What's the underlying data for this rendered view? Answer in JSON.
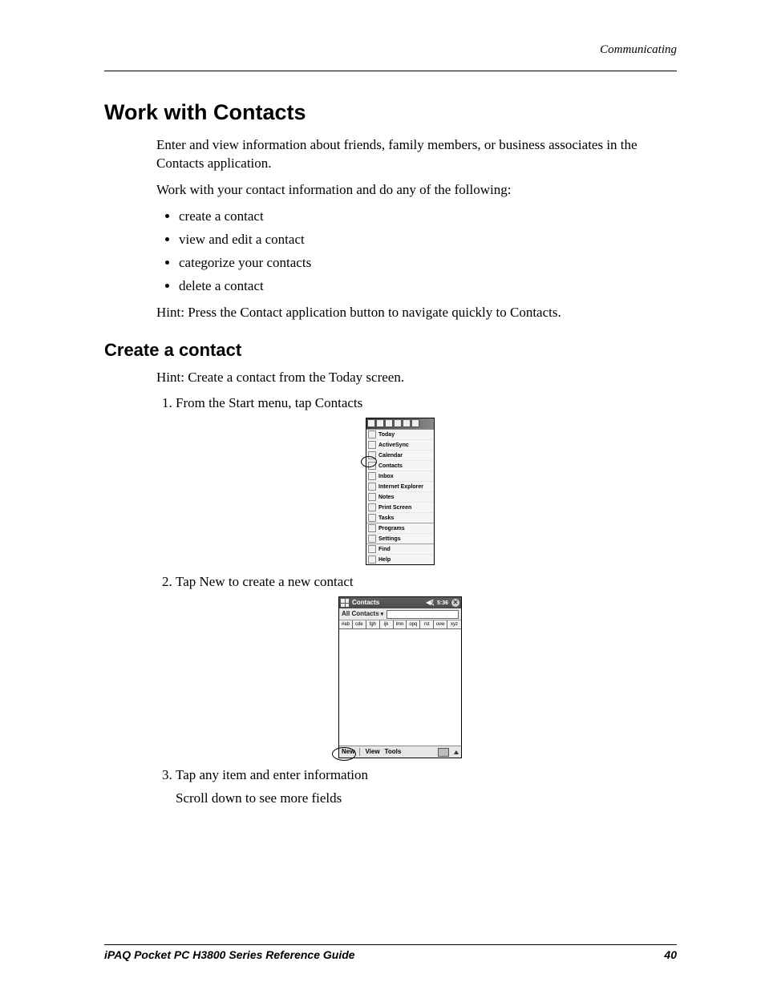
{
  "header": {
    "section": "Communicating"
  },
  "h1": "Work with Contacts",
  "intro1": "Enter and view information about friends, family members, or business associates in the Contacts application.",
  "intro2": "Work with your contact information and do any of the following:",
  "bullets": [
    "create a contact",
    "view and edit a contact",
    "categorize your contacts",
    "delete a contact"
  ],
  "hint1": "Hint: Press the Contact application button to navigate quickly to Contacts.",
  "h2": "Create a contact",
  "hint2": "Hint: Create a contact from the Today screen.",
  "steps": {
    "s1": "From the Start menu, tap Contacts",
    "s2": "Tap New to create a new contact",
    "s3": "Tap any item and enter information",
    "s3b": "Scroll down to see more fields"
  },
  "shot1": {
    "items_a": [
      "Today",
      "ActiveSync",
      "Calendar",
      "Contacts",
      "Inbox",
      "Internet Explorer",
      "Notes",
      "Print Screen",
      "Tasks"
    ],
    "items_b": [
      "Programs",
      "Settings"
    ],
    "items_c": [
      "Find",
      "Help"
    ]
  },
  "shot2": {
    "title": "Contacts",
    "time": "5:36",
    "dd": "All Contacts",
    "alpha": [
      "#ab",
      "cde",
      "fgh",
      "ijk",
      "lmn",
      "opq",
      "rst",
      "uvw",
      "xyz"
    ],
    "cmd": {
      "new": "New",
      "view": "View",
      "tools": "Tools"
    }
  },
  "footer": {
    "book": "iPAQ Pocket PC H3800 Series Reference Guide",
    "page": "40"
  }
}
